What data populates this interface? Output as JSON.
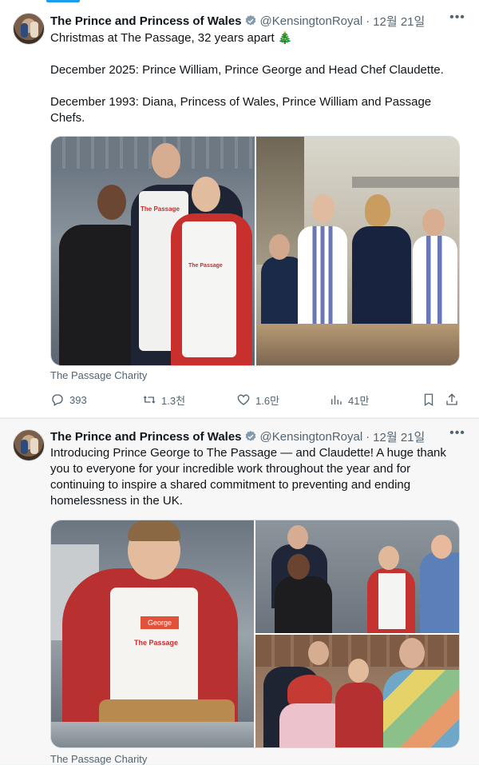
{
  "tweets": [
    {
      "author_name": "The Prince and Princess of Wales",
      "handle": "@KensingtonRoyal",
      "separator": "·",
      "date": "12월 21일",
      "text_line1": "Christmas at The Passage, 32 years apart 🎄",
      "text_line2": "December 2025: Prince William, Prince George and Head Chef Claudette.",
      "text_line3": "December 1993: Diana, Princess of Wales, Prince William and Passage Chefs.",
      "source": "The Passage Charity",
      "image_apron_label": "The Passage",
      "stats": {
        "replies": "393",
        "reposts": "1.3천",
        "likes": "1.6만",
        "views": "41만"
      }
    },
    {
      "author_name": "The Prince and Princess of Wales",
      "handle": "@KensingtonRoyal",
      "separator": "·",
      "date": "12월 21일",
      "text": "Introducing Prince George to The Passage — and Claudette! A huge thank you to everyone for your incredible work throughout the year and for continuing to inspire a shared commitment to preventing and ending homelessness in the UK.",
      "source": "The Passage Charity",
      "image_apron_name": "George",
      "image_apron_label": "The Passage"
    }
  ],
  "icons": {
    "more": "more-icon",
    "verified": "verified-badge-icon",
    "reply": "reply-icon",
    "repost": "repost-icon",
    "like": "like-icon",
    "views": "views-icon",
    "bookmark": "bookmark-icon",
    "share": "share-icon"
  },
  "colors": {
    "accent": "#1d9bf0",
    "secondary_text": "#536471"
  }
}
